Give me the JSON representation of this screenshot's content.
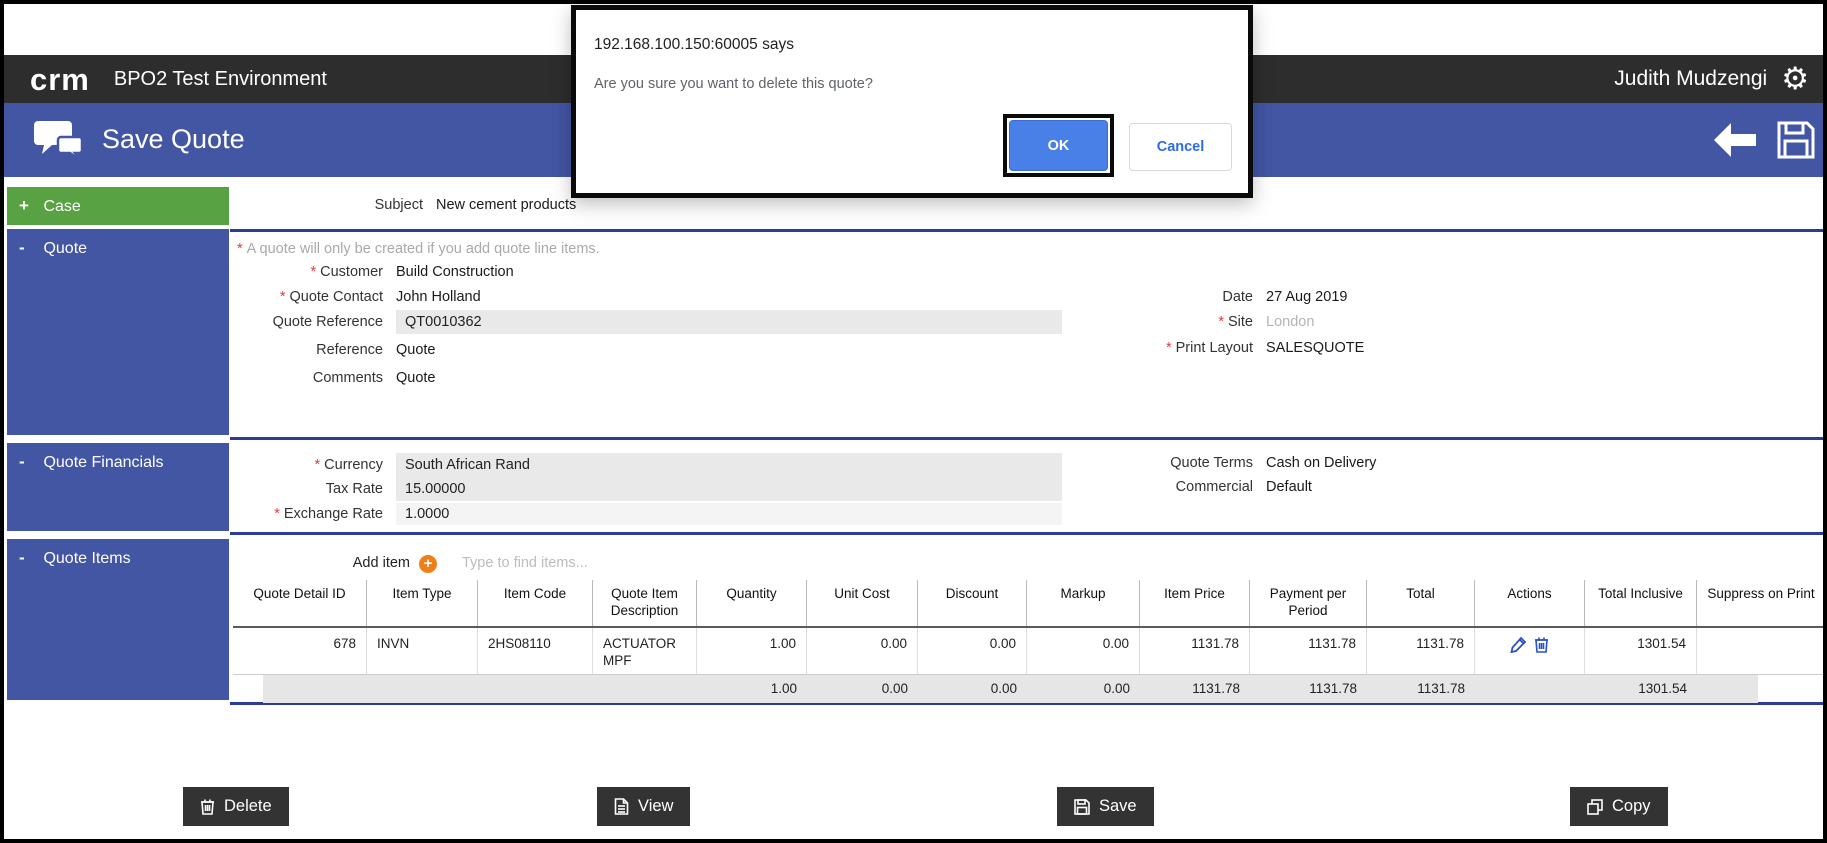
{
  "icons": {
    "gear_glyph": "⚙"
  },
  "misc": {
    "required_marker": "*"
  },
  "header": {
    "logo_text": "crm",
    "app_title": "BPO2 Test Environment",
    "user_name": "Judith Mudzengi"
  },
  "toolbar": {
    "title": "Save Quote"
  },
  "dialog": {
    "title": "192.168.100.150:60005 says",
    "message": "Are you sure you want to delete this quote?",
    "ok_label": "OK",
    "cancel_label": "Cancel"
  },
  "sections": {
    "case": {
      "title": "Case",
      "toggle": "+",
      "subject": {
        "label": "Subject",
        "value": "New cement products"
      }
    },
    "quote": {
      "title": "Quote",
      "toggle": "-",
      "note": "A quote will only be created if you add quote line items.",
      "customer": {
        "label": "Customer",
        "value": "Build Construction"
      },
      "quote_contact": {
        "label": "Quote Contact",
        "value": "John Holland"
      },
      "quote_reference": {
        "label": "Quote Reference",
        "value": "QT0010362"
      },
      "reference": {
        "label": "Reference",
        "value": "Quote"
      },
      "comments": {
        "label": "Comments",
        "value": "Quote"
      },
      "date": {
        "label": "Date",
        "value": "27 Aug 2019"
      },
      "site": {
        "label": "Site",
        "value": "London"
      },
      "print_layout": {
        "label": "Print Layout",
        "value": "SALESQUOTE"
      }
    },
    "financials": {
      "title": "Quote Financials",
      "toggle": "-",
      "currency": {
        "label": "Currency",
        "value": "South African Rand"
      },
      "tax_rate": {
        "label": "Tax Rate",
        "value": "15.00000"
      },
      "exchange_rate": {
        "label": "Exchange Rate",
        "value": "1.0000"
      },
      "quote_terms": {
        "label": "Quote Terms",
        "value": "Cash on Delivery"
      },
      "commercial": {
        "label": "Commercial",
        "value": "Default"
      }
    },
    "items": {
      "title": "Quote Items",
      "toggle": "-",
      "add_item_label": "Add item",
      "add_glyph": "+",
      "search_placeholder": "Type to find items...",
      "table": {
        "columns": [
          "Quote Detail ID",
          "Item Type",
          "Item Code",
          "Quote Item Description",
          "Quantity",
          "Unit Cost",
          "Discount",
          "Markup",
          "Item Price",
          "Payment per Period",
          "Total",
          "Actions",
          "Total Inclusive",
          "Suppress on Print"
        ],
        "row": [
          "678",
          "INVN",
          "2HS08110",
          "ACTUATOR MPF",
          "1.00",
          "0.00",
          "0.00",
          "0.00",
          "1131.78",
          "1131.78",
          "1131.78",
          "",
          "1301.54",
          ""
        ],
        "totals": [
          "",
          "",
          "",
          "",
          "1.00",
          "0.00",
          "0.00",
          "0.00",
          "1131.78",
          "1131.78",
          "1131.78",
          "",
          "1301.54",
          ""
        ]
      }
    }
  },
  "footer": {
    "buttons": [
      {
        "label": "Delete",
        "icon": "trash-icon"
      },
      {
        "label": "View",
        "icon": "document-icon"
      },
      {
        "label": "Save",
        "icon": "save-icon"
      },
      {
        "label": "Copy",
        "icon": "copy-icon"
      }
    ]
  }
}
